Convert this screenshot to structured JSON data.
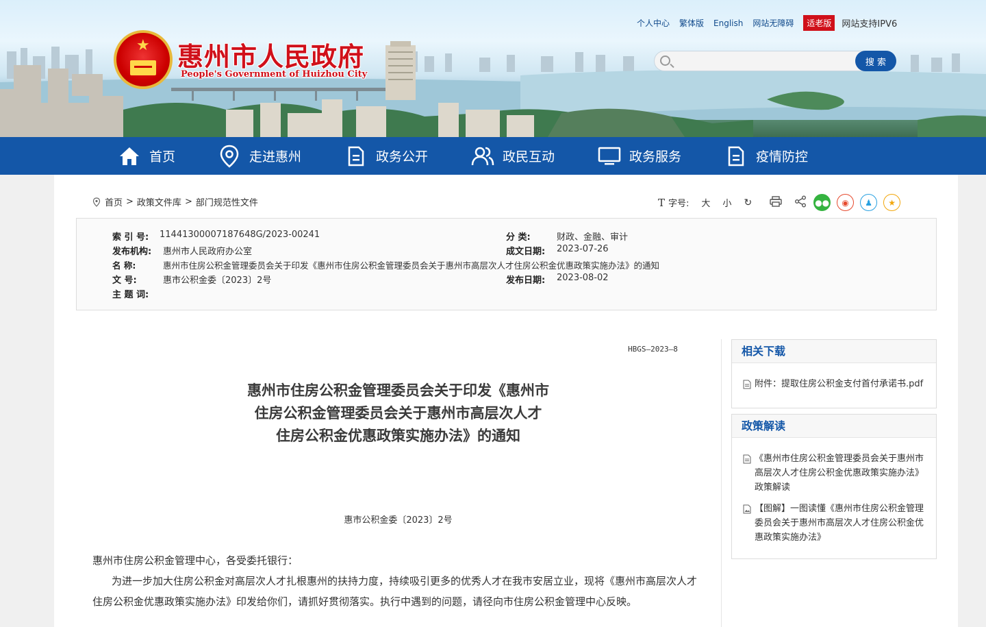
{
  "header": {
    "title": "惠州市人民政府",
    "subtitle": "People's Government of Huizhou City",
    "top_links": [
      "个人中心",
      "繁体版",
      "English",
      "网站无障碍"
    ],
    "elder_mode": "适老版",
    "ipv6": "网站支持IPV6",
    "search": {
      "placeholder": "",
      "button": "搜 索"
    }
  },
  "nav": [
    {
      "label": "首页",
      "icon": "home-icon"
    },
    {
      "label": "走进惠州",
      "icon": "location-icon"
    },
    {
      "label": "政务公开",
      "icon": "document-icon"
    },
    {
      "label": "政民互动",
      "icon": "people-icon"
    },
    {
      "label": "政务服务",
      "icon": "monitor-icon"
    },
    {
      "label": "疫情防控",
      "icon": "document-icon"
    }
  ],
  "breadcrumb": [
    "首页",
    ">",
    "政策文件库",
    ">",
    "部门规范性文件"
  ],
  "tools": {
    "font_label": "字号:",
    "large": "大",
    "small": "小"
  },
  "meta": {
    "index_no_k": "索 引 号:",
    "index_no": "11441300007187648G/2023-00241",
    "category_k": "分 类:",
    "category": "财政、金融、审计",
    "publisher_k": "发布机构:",
    "publisher": "惠州市人民政府办公室",
    "written_k": "成文日期:",
    "written": "2023-07-26",
    "name_k": "名 称:",
    "name": "惠州市住房公积金管理委员会关于印发《惠州市住房公积金管理委员会关于惠州市高层次人才住房公积金优惠政策实施办法》的通知",
    "docno_k": "文 号:",
    "docno": "惠市公积金委〔2023〕2号",
    "published_k": "发布日期:",
    "published": "2023-08-02",
    "keywords_k": "主 题 词:",
    "keywords": ""
  },
  "doc": {
    "code": "HBGS—2023—8",
    "title_lines": [
      "惠州市住房公积金管理委员会关于印发《惠州市",
      "住房公积金管理委员会关于惠州市高层次人才",
      "住房公积金优惠政策实施办法》的通知"
    ],
    "number": "惠市公积金委〔2023〕2号",
    "greeting": "惠州市住房公积金管理中心，各受委托银行：",
    "body": "为进一步加大住房公积金对高层次人才扎根惠州的扶持力度，持续吸引更多的优秀人才在我市安居立业，现将《惠州市高层次人才住房公积金优惠政策实施办法》印发给你们，请抓好贯彻落实。执行中遇到的问题，请径向市住房公积金管理中心反映。"
  },
  "sidebar": {
    "downloads_title": "相关下载",
    "downloads": [
      "附件：提取住房公积金支付首付承诺书.pdf"
    ],
    "interpretation_title": "政策解读",
    "interpretations": [
      "《惠州市住房公积金管理委员会关于惠州市高层次人才住房公积金优惠政策实施办法》政策解读",
      "【图解】一图读懂《惠州市住房公积金管理委员会关于惠州市高层次人才住房公积金优惠政策实施办法》"
    ]
  },
  "colors": {
    "primary": "#1457a8",
    "brand_red": "#d0101a"
  }
}
